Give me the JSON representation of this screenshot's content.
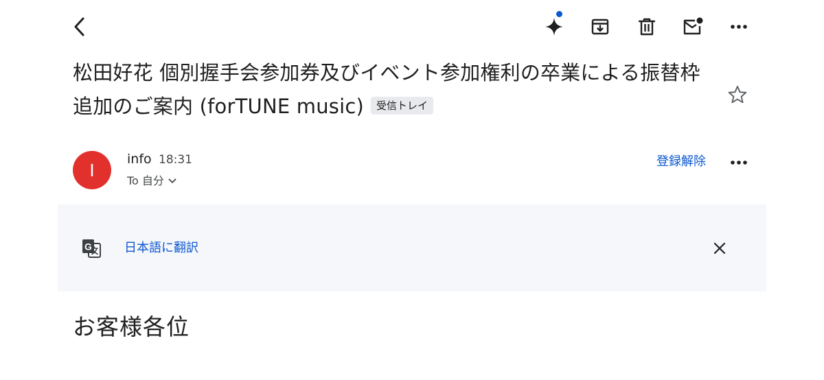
{
  "toolbar": {
    "back_icon": "arrow-back-icon",
    "actions": [
      {
        "name": "gemini-sparkle-icon",
        "has_badge": true
      },
      {
        "name": "archive-icon"
      },
      {
        "name": "delete-icon"
      },
      {
        "name": "mark-unread-icon"
      },
      {
        "name": "more-vert-icon"
      }
    ]
  },
  "email": {
    "subject": "松田好花 個別握手会参加券及びイベント参加権利の卒業による振替枠追加のご案内 (forTUNE music)",
    "label": "受信トレイ",
    "star_icon": "star-outline-icon"
  },
  "sender": {
    "avatar_letter": "I",
    "avatar_color": "#e2312d",
    "name": "info",
    "time": "18:31",
    "recipient": "To 自分",
    "unsubscribe": "登録解除"
  },
  "translate_banner": {
    "link": "日本語に翻訳",
    "icon": "translate-icon",
    "close_icon": "close-icon"
  },
  "body": {
    "greeting": "お客様各位"
  },
  "colors": {
    "accent": "#0b57d0",
    "banner_bg": "#f5f7fb",
    "chip_bg": "#e9eaee",
    "text": "#1f1f1f",
    "secondary_text": "#444746"
  }
}
